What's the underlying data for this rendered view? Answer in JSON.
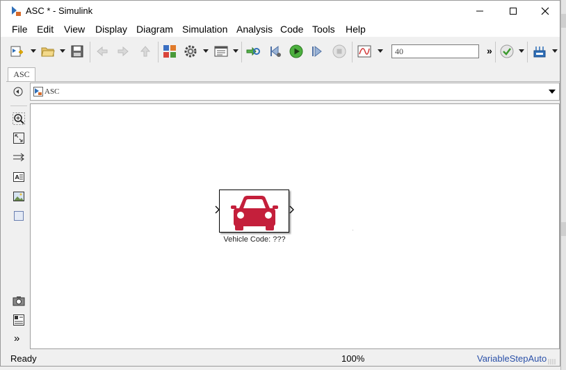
{
  "window": {
    "title": "ASC * - Simulink"
  },
  "menu": {
    "items": [
      "File",
      "Edit",
      "View",
      "Display",
      "Diagram",
      "Simulation",
      "Analysis",
      "Code",
      "Tools",
      "Help"
    ]
  },
  "toolbar": {
    "stop_time": "40",
    "more_label": "»"
  },
  "tabs": [
    {
      "label": "ASC"
    }
  ],
  "address": {
    "path": "ASC"
  },
  "model": {
    "block_label": "Vehicle Code: ???",
    "block_icon": "car-icon",
    "block_color": "#c41f3b"
  },
  "palette": {
    "expand_label": "»"
  },
  "status": {
    "state": "Ready",
    "zoom": "100%",
    "solver": "VariableStepAuto"
  }
}
